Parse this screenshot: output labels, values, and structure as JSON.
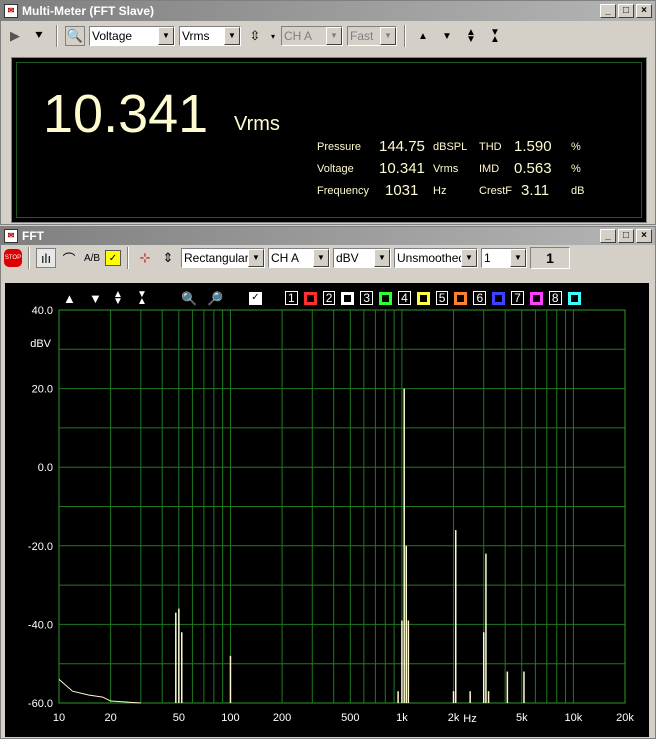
{
  "meter_window": {
    "title": "Multi-Meter (FFT Slave)",
    "mode": "Voltage",
    "units": "Vrms",
    "channel": "CH A",
    "speed": "Fast",
    "main_value": "10.341",
    "main_unit": "Vrms",
    "readings": [
      {
        "label": "Pressure",
        "value": "144.75",
        "unit": "dBSPL"
      },
      {
        "label": "Voltage",
        "value": "10.341",
        "unit": "Vrms"
      },
      {
        "label": "Frequency",
        "value": "1031",
        "unit": "Hz"
      }
    ],
    "stats": [
      {
        "label": "THD",
        "value": "1.590",
        "unit": "%"
      },
      {
        "label": "IMD",
        "value": "0.563",
        "unit": "%"
      },
      {
        "label": "CrestF",
        "value": "3.11",
        "unit": "dB"
      }
    ]
  },
  "fft_window": {
    "title": "FFT",
    "window_type": "Rectangular",
    "channel": "CH A",
    "units": "dBV",
    "smoothing": "Unsmoothed",
    "averages": "1",
    "averages_count": "1",
    "channels": [
      "1",
      "2",
      "3",
      "4",
      "5",
      "6",
      "7",
      "8"
    ],
    "channel_colors": [
      "#ff3030",
      "#ffffff",
      "#30ff30",
      "#ffff40",
      "#ff8030",
      "#4040ff",
      "#ff40ff",
      "#40ffff"
    ]
  },
  "chart_data": {
    "type": "line",
    "ylabel": "dBV",
    "xlabel": "Hz",
    "ylim": [
      -60,
      40
    ],
    "xlim": [
      10,
      20000
    ],
    "x_scale": "log",
    "grid": true,
    "trace_color": "#fffbd0",
    "y_ticks": [
      "40.0",
      "20.0",
      "0.0",
      "-20.0",
      "-40.0",
      "-60.0"
    ],
    "y_tick_values": [
      40,
      20,
      0,
      -20,
      -40,
      -60
    ],
    "x_ticks": [
      "10",
      "20",
      "50",
      "100",
      "200",
      "500",
      "1k",
      "2k",
      "5k",
      "10k",
      "20k"
    ],
    "x_tick_values": [
      10,
      20,
      50,
      100,
      200,
      500,
      1000,
      2000,
      5000,
      10000,
      20000
    ],
    "peaks": [
      {
        "x": 48,
        "y": -37
      },
      {
        "x": 50,
        "y": -36
      },
      {
        "x": 52,
        "y": -42
      },
      {
        "x": 100,
        "y": -48
      },
      {
        "x": 950,
        "y": -57
      },
      {
        "x": 1000,
        "y": -39
      },
      {
        "x": 1031,
        "y": 20
      },
      {
        "x": 1060,
        "y": -20
      },
      {
        "x": 1090,
        "y": -39
      },
      {
        "x": 2000,
        "y": -57
      },
      {
        "x": 2060,
        "y": -16
      },
      {
        "x": 2500,
        "y": -57
      },
      {
        "x": 3090,
        "y": -22
      },
      {
        "x": 3000,
        "y": -42
      },
      {
        "x": 3200,
        "y": -57
      },
      {
        "x": 4120,
        "y": -52
      },
      {
        "x": 5150,
        "y": -52
      }
    ],
    "noise_floor": [
      {
        "x": 10,
        "y": -54
      },
      {
        "x": 12,
        "y": -57
      },
      {
        "x": 15,
        "y": -58
      },
      {
        "x": 18,
        "y": -58.5
      },
      {
        "x": 20,
        "y": -59.5
      },
      {
        "x": 30,
        "y": -60
      }
    ]
  }
}
